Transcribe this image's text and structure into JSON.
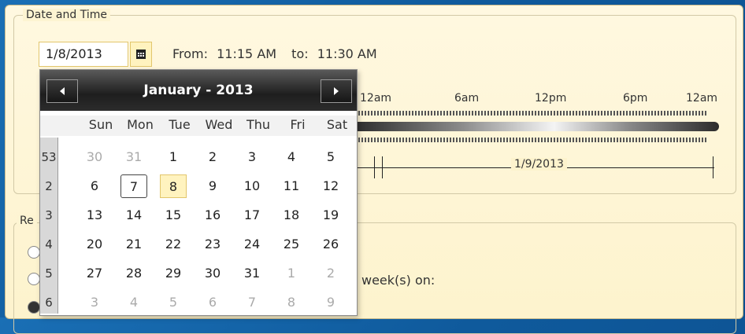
{
  "date_time_group": {
    "legend": "Date and Time",
    "date_value": "1/8/2013",
    "from_label": "From:",
    "from_time": "11:15 AM",
    "to_label": "to:",
    "to_time": "11:30 AM"
  },
  "timeline": {
    "ticks": [
      "12am",
      "6am",
      "12pm",
      "6pm",
      "12am"
    ],
    "range_label": "1/9/2013"
  },
  "recurrence_group": {
    "legend_partial": "Re",
    "weeks_label": "week(s) on:"
  },
  "calendar": {
    "title": "January - 2013",
    "prev_icon": "chevron-left-icon",
    "next_icon": "chevron-right-icon",
    "weekdays": [
      "Sun",
      "Mon",
      "Tue",
      "Wed",
      "Thu",
      "Fri",
      "Sat"
    ],
    "weeks": [
      {
        "num": "53",
        "days": [
          "30",
          "31",
          "1",
          "2",
          "3",
          "4",
          "5"
        ],
        "muted": [
          true,
          true,
          false,
          false,
          false,
          false,
          false
        ]
      },
      {
        "num": "2",
        "days": [
          "6",
          "7",
          "8",
          "9",
          "10",
          "11",
          "12"
        ],
        "muted": [
          false,
          false,
          false,
          false,
          false,
          false,
          false
        ]
      },
      {
        "num": "3",
        "days": [
          "13",
          "14",
          "15",
          "16",
          "17",
          "18",
          "19"
        ],
        "muted": [
          false,
          false,
          false,
          false,
          false,
          false,
          false
        ]
      },
      {
        "num": "4",
        "days": [
          "20",
          "21",
          "22",
          "23",
          "24",
          "25",
          "26"
        ],
        "muted": [
          false,
          false,
          false,
          false,
          false,
          false,
          false
        ]
      },
      {
        "num": "5",
        "days": [
          "27",
          "28",
          "29",
          "30",
          "31",
          "1",
          "2"
        ],
        "muted": [
          false,
          false,
          false,
          false,
          false,
          true,
          true
        ]
      },
      {
        "num": "6",
        "days": [
          "3",
          "4",
          "5",
          "6",
          "7",
          "8",
          "9"
        ],
        "muted": [
          true,
          true,
          true,
          true,
          true,
          true,
          true
        ]
      }
    ],
    "today": "7",
    "selected": "8"
  },
  "colors": {
    "background": "#0f5a9c",
    "pane": "#fdf3cd",
    "accent": "#e2c66c",
    "header": "#1e1e1e"
  }
}
